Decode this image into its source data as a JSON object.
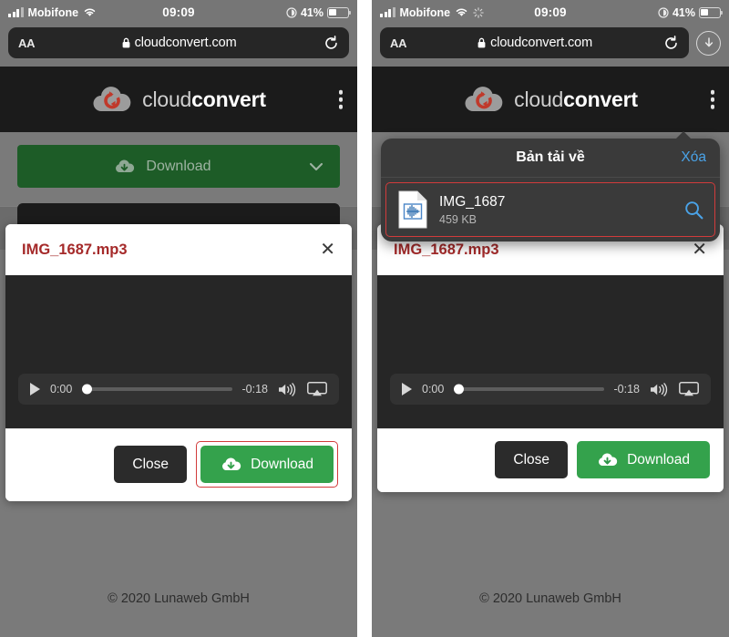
{
  "panels": [
    {
      "id": "left",
      "status_bar": {
        "carrier": "Mobifone",
        "time": "09:09",
        "battery_percent": "41%",
        "signal_icon": "cellular-bars-icon",
        "wifi_icon": "wifi-icon",
        "location_icon": "location-services-icon",
        "battery_icon": "battery-icon",
        "spinner_visible": false
      },
      "url_bar": {
        "text_size_label": "AA",
        "lock_icon": "lock-icon",
        "url": "cloudconvert.com",
        "reload_icon": "reload-icon",
        "downloads_button_visible": false,
        "downloads_icon": "download-arrow-circle-icon"
      },
      "site": {
        "brand_light": "cloud",
        "brand_bold": "convert",
        "logo_icon": "cloudconvert-logo-icon",
        "menu_icon": "kebab-menu-icon",
        "download_button_label": "Download",
        "download_button_icon": "cloud-download-icon",
        "download_button_chevron": "chevron-down-icon",
        "copyright": "© 2020 Lunaweb GmbH"
      },
      "modal": {
        "title": "IMG_1687.mp3",
        "close_icon": "close-icon",
        "player": {
          "play_icon": "play-icon",
          "current_time": "0:00",
          "remaining_time": "-0:18",
          "volume_icon": "volume-high-icon",
          "airplay_icon": "airplay-icon",
          "progress_percent": 0
        },
        "close_label": "Close",
        "download_label": "Download",
        "download_icon": "cloud-download-icon",
        "download_highlighted": true
      },
      "downloads_popover": null,
      "toolbar": {
        "back_icon": "chevron-left-icon",
        "forward_icon": "chevron-right-icon",
        "share_icon": "share-icon",
        "bookmarks_icon": "book-icon",
        "tabs_icon": "tabs-icon",
        "back_enabled": true,
        "forward_enabled": false
      }
    },
    {
      "id": "right",
      "status_bar": {
        "carrier": "Mobifone",
        "time": "09:09",
        "battery_percent": "41%",
        "signal_icon": "cellular-bars-icon",
        "wifi_icon": "wifi-icon",
        "location_icon": "location-services-icon",
        "battery_icon": "battery-icon",
        "spinner_visible": true,
        "spinner_icon": "activity-spinner-icon"
      },
      "url_bar": {
        "text_size_label": "AA",
        "lock_icon": "lock-icon",
        "url": "cloudconvert.com",
        "reload_icon": "reload-icon",
        "downloads_button_visible": true,
        "downloads_icon": "download-arrow-circle-icon"
      },
      "site": {
        "brand_light": "cloud",
        "brand_bold": "convert",
        "logo_icon": "cloudconvert-logo-icon",
        "menu_icon": "kebab-menu-icon",
        "download_button_label": "Download",
        "download_button_icon": "cloud-download-icon",
        "download_button_chevron": "chevron-down-icon",
        "copyright": "© 2020 Lunaweb GmbH"
      },
      "modal": {
        "title": "IMG_1687.mp3",
        "close_icon": "close-icon",
        "player": {
          "play_icon": "play-icon",
          "current_time": "0:00",
          "remaining_time": "-0:18",
          "volume_icon": "volume-high-icon",
          "airplay_icon": "airplay-icon",
          "progress_percent": 0
        },
        "close_label": "Close",
        "download_label": "Download",
        "download_icon": "cloud-download-icon",
        "download_highlighted": false
      },
      "downloads_popover": {
        "title": "Bản tải về",
        "clear_label": "Xóa",
        "highlighted": true,
        "item": {
          "file_icon": "audio-file-icon",
          "name": "IMG_1687",
          "size": "459 KB",
          "action_icon": "magnifier-icon"
        }
      },
      "toolbar": {
        "back_icon": "chevron-left-icon",
        "forward_icon": "chevron-right-icon",
        "share_icon": "share-icon",
        "bookmarks_icon": "book-icon",
        "tabs_icon": "tabs-icon",
        "back_enabled": true,
        "forward_enabled": false
      }
    }
  ],
  "colors": {
    "accent_green": "#34a24c",
    "dark_green": "#1d5c27",
    "highlight_red": "#d23b3b",
    "title_red": "#a52a2a",
    "link_blue": "#4aa3e8"
  }
}
